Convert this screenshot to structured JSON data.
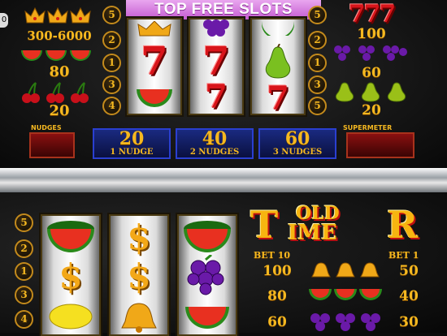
{
  "header": {
    "title": "TOP FREE SLOTS"
  },
  "side_tab": "0",
  "top_paytable_left": [
    {
      "icon": "crown-icon",
      "payout": "300-6000"
    },
    {
      "icon": "watermelon-icon",
      "payout": "80"
    },
    {
      "icon": "cherry-icon",
      "payout": "20"
    }
  ],
  "top_paytable_right": [
    {
      "icon": "seven-icon",
      "payout": "100"
    },
    {
      "icon": "grapes-icon",
      "payout": "60"
    },
    {
      "icon": "pear-icon",
      "payout": "20"
    }
  ],
  "top_line_numbers_left": [
    "5",
    "2",
    "1",
    "3",
    "4"
  ],
  "top_line_numbers_right": [
    "5",
    "2",
    "1",
    "3",
    "5"
  ],
  "top_reels": [
    [
      "crown-icon",
      "7",
      "watermelon-icon"
    ],
    [
      "grapes-icon",
      "7",
      "7"
    ],
    [
      "watermelon-icon",
      "pear-icon",
      "7"
    ]
  ],
  "nudges": {
    "label": "NUDGES",
    "options": [
      {
        "value": "20",
        "label": "1 NUDGE"
      },
      {
        "value": "40",
        "label": "2 NUDGES"
      },
      {
        "value": "60",
        "label": "3 NUDGES"
      }
    ]
  },
  "supermeter": {
    "label": "SUPERMETER"
  },
  "bottom_line_numbers": [
    "5",
    "2",
    "1",
    "3",
    "4"
  ],
  "bottom_reels": [
    [
      "watermelon-icon",
      "$",
      "lemon-icon"
    ],
    [
      "$",
      "$",
      "bell-icon"
    ],
    [
      "watermelon-icon",
      "grapes-icon",
      "watermelon-icon"
    ]
  ],
  "logo": {
    "line1": "OLD",
    "line2": "TIMER",
    "big_letter": "T",
    "letters": "IME",
    "last_letter": "R"
  },
  "bet_table": {
    "left_header": "BET 10",
    "right_header": "BET 1",
    "rows": [
      {
        "bet10": "100",
        "icon": "bell-icon",
        "bet1": "50"
      },
      {
        "bet10": "80",
        "icon": "watermelon-icon",
        "bet1": "40"
      },
      {
        "bet10": "60",
        "icon": "grapes-icon",
        "bet1": "30"
      }
    ]
  },
  "colors": {
    "gold": "#f5b820",
    "title_banner": "#d070dc",
    "seven_red": "#d8141a",
    "nudge_blue": "#2a3fd0"
  }
}
